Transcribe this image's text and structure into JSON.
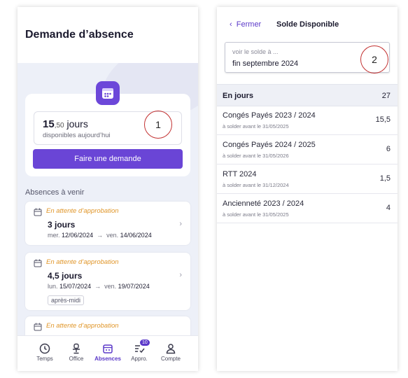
{
  "left": {
    "title": "Demande d’absence",
    "balance": {
      "value": "15",
      "decimal": ",50",
      "unit": "jours",
      "subtitle": "disponibles aujourd’hui"
    },
    "request_button": "Faire une demande",
    "marker": "1",
    "section_title": "Absences à venir",
    "absences": [
      {
        "status": "En attente d’approbation",
        "days": "3 jours",
        "from_day": "mer.",
        "from_date": "12/06/2024",
        "to_day": "ven.",
        "to_date": "14/06/2024",
        "tag": ""
      },
      {
        "status": "En attente d’approbation",
        "days": "4,5 jours",
        "from_day": "lun.",
        "from_date": "15/07/2024",
        "to_day": "ven.",
        "to_date": "19/07/2024",
        "tag": "après-midi"
      },
      {
        "status": "En attente d’approbation"
      }
    ],
    "nav": [
      {
        "label": "Temps",
        "icon": "clock-icon"
      },
      {
        "label": "Office",
        "icon": "desk-chair-icon"
      },
      {
        "label": "Absences",
        "icon": "calendar-icon",
        "active": true
      },
      {
        "label": "Appro.",
        "icon": "checklist-icon",
        "badge": "10"
      },
      {
        "label": "Compte",
        "icon": "user-icon"
      }
    ],
    "accent": "#6a45d6"
  },
  "right": {
    "back_label": "Fermer",
    "title": "Solde Disponible",
    "input_placeholder": "voir le solde à ...",
    "input_value": "fin septembre 2024",
    "marker": "2",
    "header_label": "En jours",
    "header_total": "27",
    "rows": [
      {
        "name": "Congés Payés 2023 / 2024",
        "deadline": "à solder avant le 31/05/2025",
        "value": "15,5"
      },
      {
        "name": "Congés Payés 2024 / 2025",
        "deadline": "à solder avant le 31/05/2026",
        "value": "6"
      },
      {
        "name": "RTT 2024",
        "deadline": "à solder avant le 31/12/2024",
        "value": "1,5"
      },
      {
        "name": "Ancienneté 2023 / 2024",
        "deadline": "à solder avant le 31/05/2025",
        "value": "4"
      }
    ]
  }
}
